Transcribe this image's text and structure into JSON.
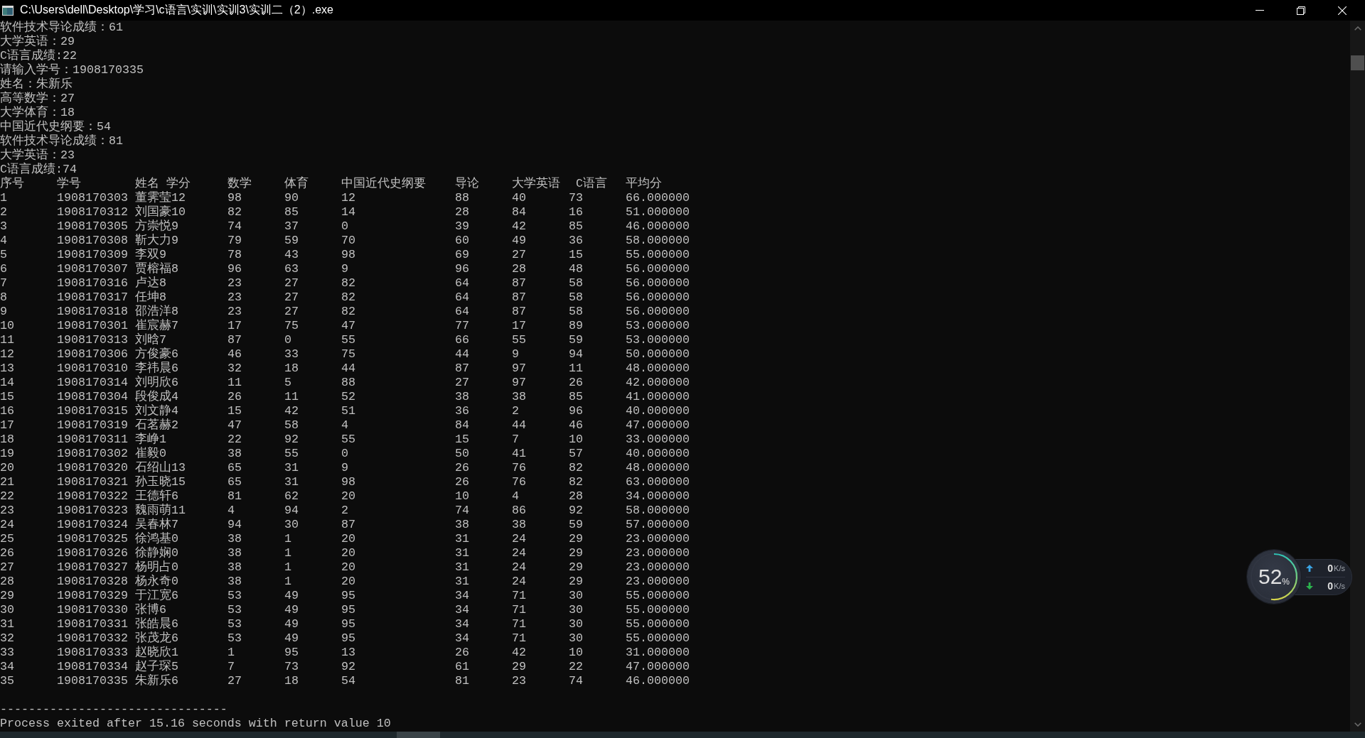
{
  "window": {
    "title": "C:\\Users\\dell\\Desktop\\学习\\c语言\\实训\\实训3\\实训二（2）.exe"
  },
  "console": {
    "lines": [
      "软件技术导论成绩：61",
      "大学英语：29",
      "C语言成绩:22",
      "请输入学号：1908170335",
      "姓名：朱新乐",
      "高等数学：27",
      "大学体育：18",
      "中国近代史纲要：54",
      "软件技术导论成绩：81",
      "大学英语：23",
      "C语言成绩:74"
    ],
    "table": {
      "columns": [
        "序号",
        "学号",
        "姓名 学分",
        "数学",
        "体育",
        "中国近代史纲要",
        "导论",
        "大学英语",
        "C语言",
        "平均分"
      ],
      "rows": [
        [
          "1",
          "1908170303",
          "董霁莹12",
          "98",
          "90",
          "12",
          "88",
          "40",
          "73",
          "66.000000"
        ],
        [
          "2",
          "1908170312",
          "刘国豪10",
          "82",
          "85",
          "14",
          "28",
          "84",
          "16",
          "51.000000"
        ],
        [
          "3",
          "1908170305",
          "方崇悦9",
          "74",
          "37",
          "0",
          "39",
          "42",
          "85",
          "46.000000"
        ],
        [
          "4",
          "1908170308",
          "靳大力9",
          "79",
          "59",
          "70",
          "60",
          "49",
          "36",
          "58.000000"
        ],
        [
          "5",
          "1908170309",
          "李双9",
          "78",
          "43",
          "98",
          "69",
          "27",
          "15",
          "55.000000"
        ],
        [
          "6",
          "1908170307",
          "贾榕福8",
          "96",
          "63",
          "9",
          "96",
          "28",
          "48",
          "56.000000"
        ],
        [
          "7",
          "1908170316",
          "卢达8",
          "23",
          "27",
          "82",
          "64",
          "87",
          "58",
          "56.000000"
        ],
        [
          "8",
          "1908170317",
          "任坤8",
          "23",
          "27",
          "82",
          "64",
          "87",
          "58",
          "56.000000"
        ],
        [
          "9",
          "1908170318",
          "邵浩洋8",
          "23",
          "27",
          "82",
          "64",
          "87",
          "58",
          "56.000000"
        ],
        [
          "10",
          "1908170301",
          "崔宸赫7",
          "17",
          "75",
          "47",
          "77",
          "17",
          "89",
          "53.000000"
        ],
        [
          "11",
          "1908170313",
          "刘晗7",
          "87",
          "0",
          "55",
          "66",
          "55",
          "59",
          "53.000000"
        ],
        [
          "12",
          "1908170306",
          "方俊豪6",
          "46",
          "33",
          "75",
          "44",
          "9",
          "94",
          "50.000000"
        ],
        [
          "13",
          "1908170310",
          "李祎晨6",
          "32",
          "18",
          "44",
          "87",
          "97",
          "11",
          "48.000000"
        ],
        [
          "14",
          "1908170314",
          "刘明欣6",
          "11",
          "5",
          "88",
          "27",
          "97",
          "26",
          "42.000000"
        ],
        [
          "15",
          "1908170304",
          "段俊成4",
          "26",
          "11",
          "52",
          "38",
          "38",
          "85",
          "41.000000"
        ],
        [
          "16",
          "1908170315",
          "刘文静4",
          "15",
          "42",
          "51",
          "36",
          "2",
          "96",
          "40.000000"
        ],
        [
          "17",
          "1908170319",
          "石茗赫2",
          "47",
          "58",
          "4",
          "84",
          "44",
          "46",
          "47.000000"
        ],
        [
          "18",
          "1908170311",
          "李峥1",
          "22",
          "92",
          "55",
          "15",
          "7",
          "10",
          "33.000000"
        ],
        [
          "19",
          "1908170302",
          "崔毅0",
          "38",
          "55",
          "0",
          "50",
          "41",
          "57",
          "40.000000"
        ],
        [
          "20",
          "1908170320",
          "石绍山13",
          "65",
          "31",
          "9",
          "26",
          "76",
          "82",
          "48.000000"
        ],
        [
          "21",
          "1908170321",
          "孙玉晓15",
          "65",
          "31",
          "98",
          "26",
          "76",
          "82",
          "63.000000"
        ],
        [
          "22",
          "1908170322",
          "王德轩6",
          "81",
          "62",
          "20",
          "10",
          "4",
          "28",
          "34.000000"
        ],
        [
          "23",
          "1908170323",
          "魏雨萌11",
          "4",
          "94",
          "2",
          "74",
          "86",
          "92",
          "58.000000"
        ],
        [
          "24",
          "1908170324",
          "吴春林7",
          "94",
          "30",
          "87",
          "38",
          "38",
          "59",
          "57.000000"
        ],
        [
          "25",
          "1908170325",
          "徐鸿基0",
          "38",
          "1",
          "20",
          "31",
          "24",
          "29",
          "23.000000"
        ],
        [
          "26",
          "1908170326",
          "徐静娴0",
          "38",
          "1",
          "20",
          "31",
          "24",
          "29",
          "23.000000"
        ],
        [
          "27",
          "1908170327",
          "杨明占0",
          "38",
          "1",
          "20",
          "31",
          "24",
          "29",
          "23.000000"
        ],
        [
          "28",
          "1908170328",
          "杨永奇0",
          "38",
          "1",
          "20",
          "31",
          "24",
          "29",
          "23.000000"
        ],
        [
          "29",
          "1908170329",
          "于江宽6",
          "53",
          "49",
          "95",
          "34",
          "71",
          "30",
          "55.000000"
        ],
        [
          "30",
          "1908170330",
          "张博6",
          "53",
          "49",
          "95",
          "34",
          "71",
          "30",
          "55.000000"
        ],
        [
          "31",
          "1908170331",
          "张皓晨6",
          "53",
          "49",
          "95",
          "34",
          "71",
          "30",
          "55.000000"
        ],
        [
          "32",
          "1908170332",
          "张茂龙6",
          "53",
          "49",
          "95",
          "34",
          "71",
          "30",
          "55.000000"
        ],
        [
          "33",
          "1908170333",
          "赵晓欣1",
          "1",
          "95",
          "13",
          "26",
          "42",
          "10",
          "31.000000"
        ],
        [
          "34",
          "1908170334",
          "赵子琛5",
          "7",
          "73",
          "92",
          "61",
          "29",
          "22",
          "47.000000"
        ],
        [
          "35",
          "1908170335",
          "朱新乐6",
          "27",
          "18",
          "54",
          "81",
          "23",
          "74",
          "46.000000"
        ]
      ]
    },
    "separator": "--------------------------------",
    "exit_message": "Process exited after 15.16 seconds with return value 10"
  },
  "speed_widget": {
    "level": 0.52,
    "percent": "52",
    "percent_unit": "%",
    "speeds": [
      {
        "kind": "upload",
        "value": "0",
        "unit": "K/s"
      },
      {
        "kind": "download",
        "value": "0",
        "unit": "K/s"
      }
    ]
  }
}
